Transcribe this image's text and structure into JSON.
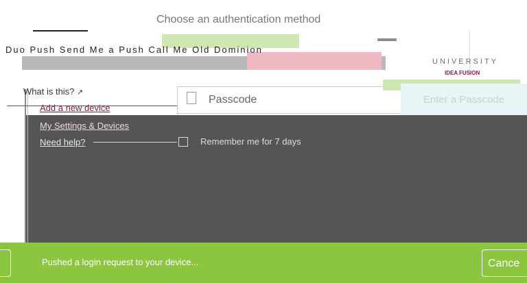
{
  "auth": {
    "heading": "Choose an authentication method",
    "glitch_row_text": "Duo Push  Send Me a Push  Call Me  Old Dominion",
    "what_is_this": "What is this?",
    "add_device": "Add a new device",
    "my_settings": "My Settings & Devices",
    "need_help": "Need help?",
    "passcode_placeholder": "Passcode",
    "passcode_button": "Enter a Passcode",
    "remember_label": "Remember me for 7 days"
  },
  "branding": {
    "university": "UNIVERSITY",
    "tagline": "IDEA FUSION",
    "brand_color": "#8b1c3d"
  },
  "banner": {
    "message": "Pushed a login request to your device...",
    "cancel_label": "Cance",
    "color": "#8cc63f"
  },
  "icons": [
    "external-link-icon",
    "phone-icon",
    "checkbox-icon"
  ]
}
